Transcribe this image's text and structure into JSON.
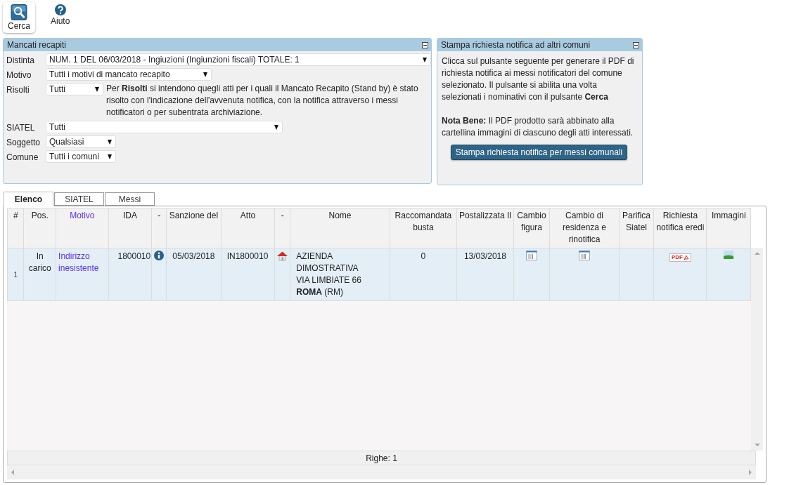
{
  "toolbar": [
    {
      "label": "Cerca",
      "kind": "search",
      "selected": true
    },
    {
      "label": "Aiuto",
      "kind": "help",
      "selected": false
    }
  ],
  "filter_panel": {
    "title": "Mancati recapiti",
    "fields": [
      {
        "label": "Distinta",
        "value": "NUM. 1 DEL 06/03/2018 - Ingiuzioni (Ingiunzioni fiscali) TOTALE: 1"
      },
      {
        "label": "Motivo",
        "value": "Tutti i motivi di mancato recapito"
      },
      {
        "label": "Risolti",
        "value": "Tutti",
        "note": "Per **Risolti** si intendono quegli atti per i quali il Mancato Recapito (Stand by) è stato risolto con l'indicazione dell'avvenuta notifica, con la notifica attraverso i messi notificatori o per subentrata archiviazione."
      },
      {
        "label": "SIATEL",
        "value": "Tutti"
      },
      {
        "label": "Soggetto",
        "value": "Qualsiasi"
      },
      {
        "label": "Comune",
        "value": "Tutti i comuni"
      }
    ]
  },
  "print_panel": {
    "title": "Stampa richiesta notifica ad altri comuni",
    "paragraphs": [
      "Clicca sul pulsante seguente per generare il PDF di richiesta notifica ai messi notificatori del comune selezionato. Il pulsante si abilita una volta selezionati i nominativi con il pulsante **Cerca**",
      "**Nota Bene:** Il PDF prodotto sarà abbinato alla cartellina immagini di ciascuno degli atti interessati."
    ],
    "button": "Stampa richiesta notifica per messi comunali"
  },
  "tabs": [
    {
      "label": "Elenco",
      "selected": true
    },
    {
      "label": "SIATEL",
      "selected": false
    },
    {
      "label": "Messi",
      "selected": false
    }
  ],
  "table": {
    "columns": [
      {
        "label": "#",
        "kind": "text"
      },
      {
        "label": "Pos.",
        "kind": "text"
      },
      {
        "label": "Motivo",
        "kind": "link"
      },
      {
        "label": "IDA",
        "kind": "text"
      },
      {
        "label": "-",
        "kind": "text"
      },
      {
        "label": "Sanzione del",
        "kind": "text"
      },
      {
        "label": "Atto",
        "kind": "text"
      },
      {
        "label": "-",
        "kind": "text"
      },
      {
        "label": "Nome",
        "kind": "text"
      },
      {
        "label": "Raccomandata busta",
        "kind": "text"
      },
      {
        "label": "Postalizzata Il",
        "kind": "text"
      },
      {
        "label": "Cambio figura",
        "kind": "text"
      },
      {
        "label": "Cambio di residenza e rinotifica",
        "kind": "text"
      },
      {
        "label": "Parifica Siatel",
        "kind": "text"
      },
      {
        "label": "Richiesta notifica eredi",
        "kind": "text"
      },
      {
        "label": "Immagini",
        "kind": "text"
      }
    ],
    "rows": [
      {
        "selected": true,
        "cells": [
          {
            "kind": "index",
            "text": "1"
          },
          {
            "kind": "text",
            "text": "In carico"
          },
          {
            "kind": "link",
            "text": "Indirizzo inesistente"
          },
          {
            "kind": "number",
            "text": "1800010"
          },
          {
            "kind": "info"
          },
          {
            "kind": "text",
            "text": "05/03/2018"
          },
          {
            "kind": "left",
            "text": "IN1800010"
          },
          {
            "kind": "house"
          },
          {
            "kind": "address",
            "lines": [
              "AZIENDA",
              "DIMOSTRATIVA",
              "VIA LIMBIATE 66",
              "**ROMA** (RM)"
            ]
          },
          {
            "kind": "text",
            "text": "0"
          },
          {
            "kind": "text",
            "text": "13/03/2018"
          },
          {
            "kind": "doc"
          },
          {
            "kind": "doc"
          },
          {
            "kind": "empty"
          },
          {
            "kind": "pdf",
            "text": "PDF"
          },
          {
            "kind": "image"
          }
        ]
      }
    ],
    "footer": "Righe: 1"
  }
}
